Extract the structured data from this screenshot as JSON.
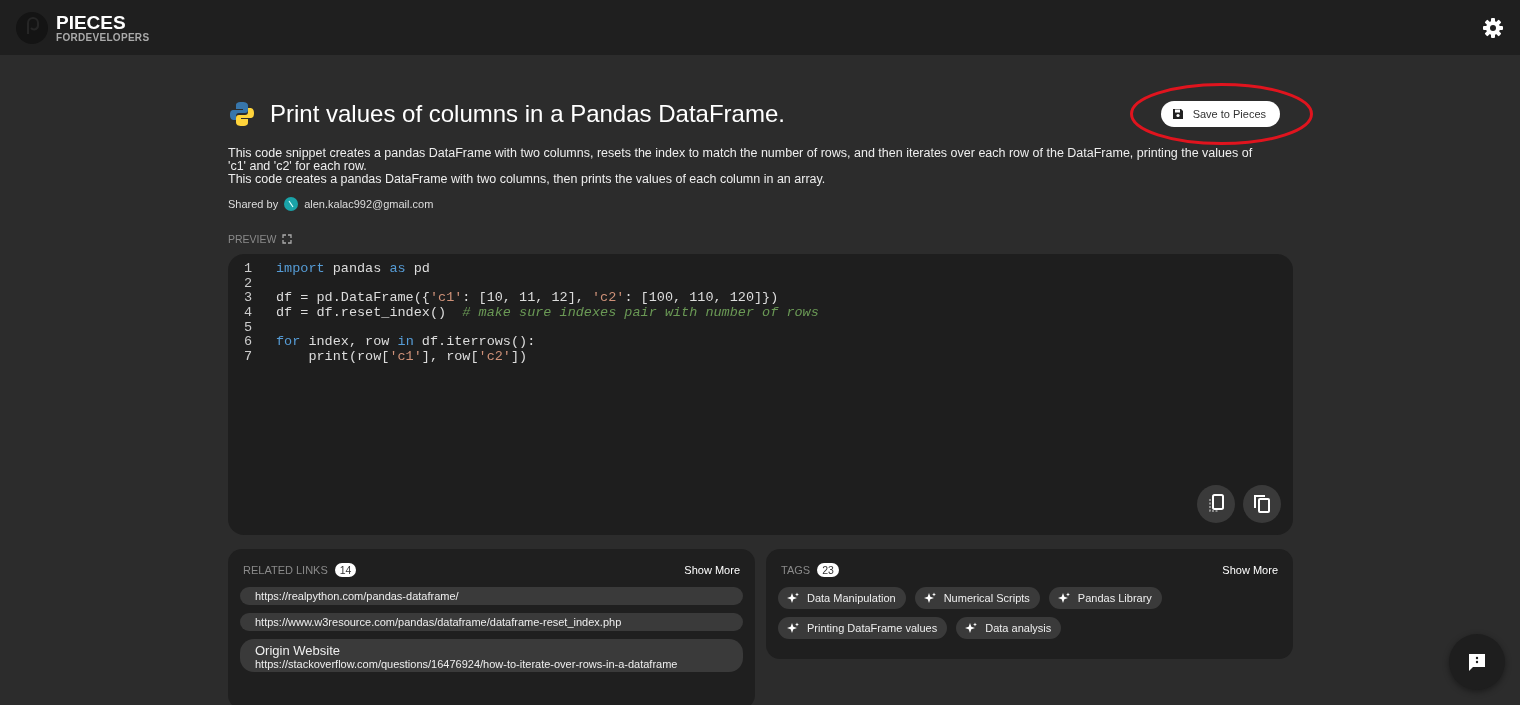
{
  "header": {
    "brand": "PIECES",
    "subbrand": "FORDEVELOPERS"
  },
  "snippet": {
    "title": "Print values of columns in a Pandas DataFrame.",
    "save_button": {
      "label": "Save to Pieces",
      "circled": true
    },
    "description": [
      "This code snippet creates a pandas DataFrame with two columns, resets the index to match the number of rows, and then iterates over each row of the DataFrame, printing the values of 'c1' and 'c2' for each row.",
      "This code creates a pandas DataFrame with two columns, then prints the values of each column in an array."
    ],
    "shared_by": {
      "label": "Shared by",
      "email": "alen.kalac992@gmail.com"
    },
    "preview_label": "PREVIEW",
    "code": [
      {
        "number": "1",
        "tokens": [
          {
            "kind": "keyword",
            "text": "import"
          },
          {
            "kind": "plain",
            "text": " pandas "
          },
          {
            "kind": "keyword",
            "text": "as"
          },
          {
            "kind": "plain",
            "text": " pd"
          }
        ]
      },
      {
        "number": "2"
      },
      {
        "number": "3",
        "tokens": [
          {
            "kind": "plain",
            "text": "df = pd.DataFrame({"
          },
          {
            "kind": "string",
            "text": "'c1'"
          },
          {
            "kind": "plain",
            "text": ": [10, 11, 12], "
          },
          {
            "kind": "string",
            "text": "'c2'"
          },
          {
            "kind": "plain",
            "text": ": [100, 110, 120]})"
          }
        ]
      },
      {
        "number": "4",
        "tokens": [
          {
            "kind": "plain",
            "text": "df = df.reset_index()  "
          },
          {
            "kind": "comment",
            "text": "# make sure indexes pair with number of rows"
          }
        ]
      },
      {
        "number": "5"
      },
      {
        "number": "6",
        "tokens": [
          {
            "kind": "keyword",
            "text": "for"
          },
          {
            "kind": "plain",
            "text": " index, row "
          },
          {
            "kind": "keyword",
            "text": "in"
          },
          {
            "kind": "plain",
            "text": " df.iterrows():"
          }
        ]
      },
      {
        "number": "7",
        "tokens": [
          {
            "kind": "plain",
            "text": "    print(row["
          },
          {
            "kind": "string",
            "text": "'c1'"
          },
          {
            "kind": "plain",
            "text": "], row["
          },
          {
            "kind": "string",
            "text": "'c2'"
          },
          {
            "kind": "plain",
            "text": "])"
          }
        ]
      }
    ]
  },
  "related_links": {
    "title": "RELATED LINKS",
    "count": "14",
    "show_more": "Show More",
    "links": [
      {
        "url": "https://realpython.com/pandas-dataframe/"
      },
      {
        "url": "https://www.w3resource.com/pandas/dataframe/dataframe-reset_index.php"
      },
      {
        "title": "Origin Website",
        "url": "https://stackoverflow.com/questions/16476924/how-to-iterate-over-rows-in-a-dataframe"
      }
    ]
  },
  "tags": {
    "title": "TAGS",
    "count": "23",
    "show_more": "Show More",
    "items": [
      "Data Manipulation",
      "Numerical Scripts",
      "Pandas Library",
      "Printing DataFrame values",
      "Data analysis"
    ]
  }
}
